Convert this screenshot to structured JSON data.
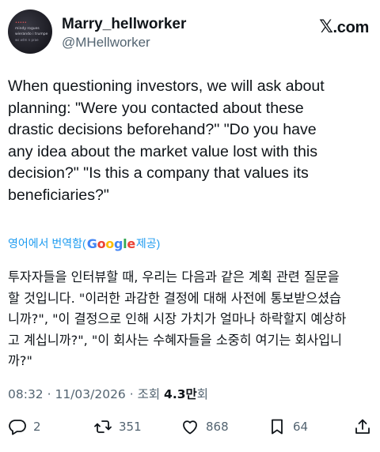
{
  "author": {
    "name": "Marry_hellworker",
    "handle": "@MHellworker",
    "avatar_lines": [
      "•••••",
      "mindy rogues",
      "wierando i trumpe",
      "ws wtm n prae"
    ]
  },
  "site": {
    "label": ".com",
    "x_glyph": "𝕏"
  },
  "tweet": {
    "text": "When questioning investors, we will ask about\nplanning: \"Were you contacted about these\ndrastic decisions beforehand?\" \"Do you have\nany idea about the market value lost with this\ndecision?\" \"Is this a company that values its\nbeneficiaries?\""
  },
  "translation": {
    "prefix": "영어에서 번역함(",
    "google_letters": [
      "G",
      "o",
      "o",
      "g",
      "l",
      "e"
    ],
    "suffix": " 제공)",
    "text": "투자자들을 인터뷰할 때, 우리는 다음과 같은 계획 관련 질문을\n할 것입니다. \"이러한 과감한 결정에 대해 사전에 통보받으셨습\n니까?\", \"이 결정으로 인해 시장 가치가 얼마나 하락할지 예상하\n고 계십니까?\", \"이 회사는 수혜자들을 소중히 여기는 회사입니\n까?\""
  },
  "meta": {
    "time": "08:32",
    "sep1": " · ",
    "date": "11/03/2026",
    "sep2": " · 조회 ",
    "views": "4.3만",
    "views_suffix": "회"
  },
  "actions": {
    "replies": "2",
    "reposts": "351",
    "likes": "868",
    "bookmarks": "64"
  },
  "colors": {
    "text": "#0f1419",
    "secondary": "#536471",
    "link": "#1d9bf0"
  }
}
